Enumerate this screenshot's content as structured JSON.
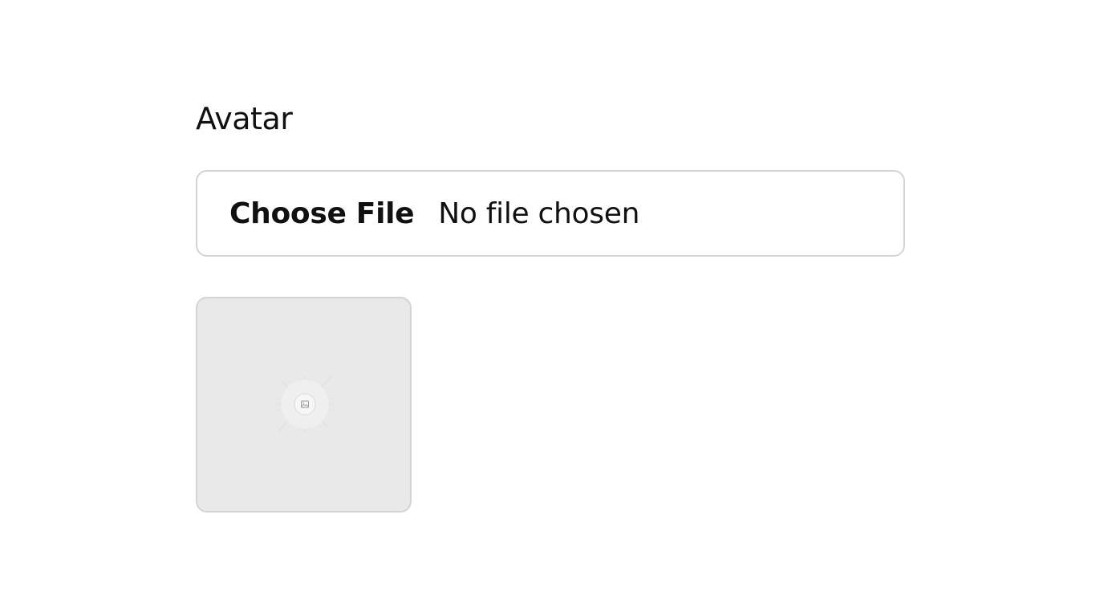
{
  "form": {
    "avatar_label": "Avatar",
    "file_input": {
      "button_label": "Choose File",
      "status": "No file chosen"
    },
    "preview": {
      "placeholder_icon": "image-placeholder-icon",
      "background": "#e9e9e9"
    }
  }
}
